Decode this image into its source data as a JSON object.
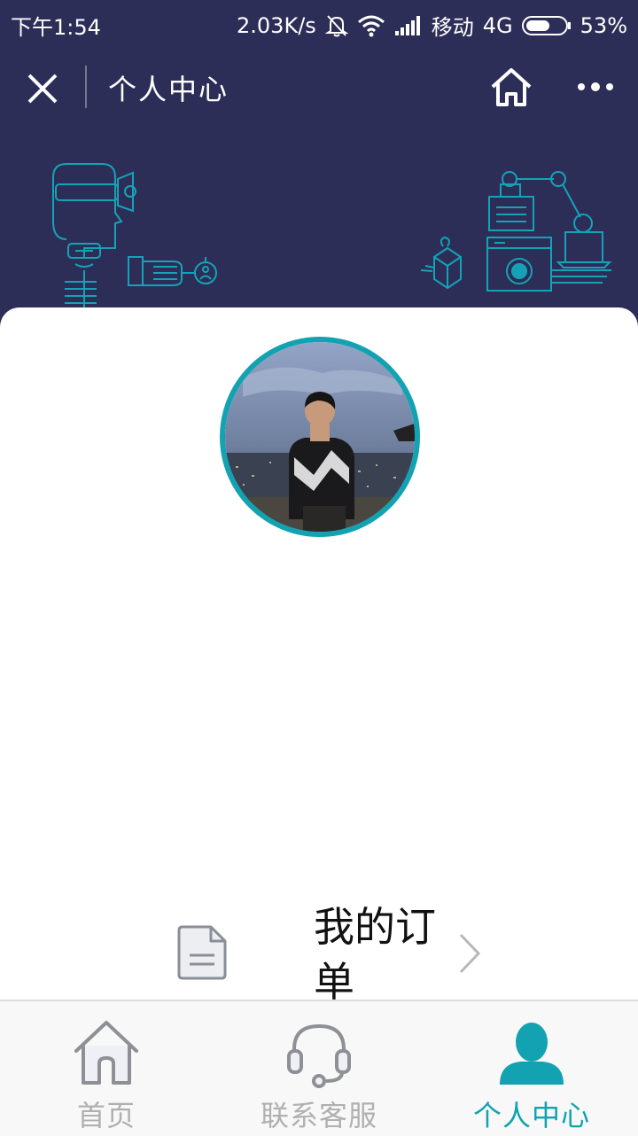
{
  "status_bar": {
    "time": "下午1:54",
    "network_speed": "2.03K/s",
    "carrier": "移动",
    "network_type": "4G",
    "battery": "53%"
  },
  "nav": {
    "title": "个人中心"
  },
  "menu": {
    "order_label": "我的订单"
  },
  "tabbar": {
    "active_index": 2,
    "items": [
      {
        "label": "首页",
        "icon": "home-icon"
      },
      {
        "label": "联系客服",
        "icon": "headset-icon"
      },
      {
        "label": "个人中心",
        "icon": "person-icon"
      }
    ]
  },
  "colors": {
    "header_bg": "#2d2e58",
    "accent": "#12a2b1",
    "tab_inactive": "#b0b0b0",
    "card_bg": "#ffffff"
  }
}
